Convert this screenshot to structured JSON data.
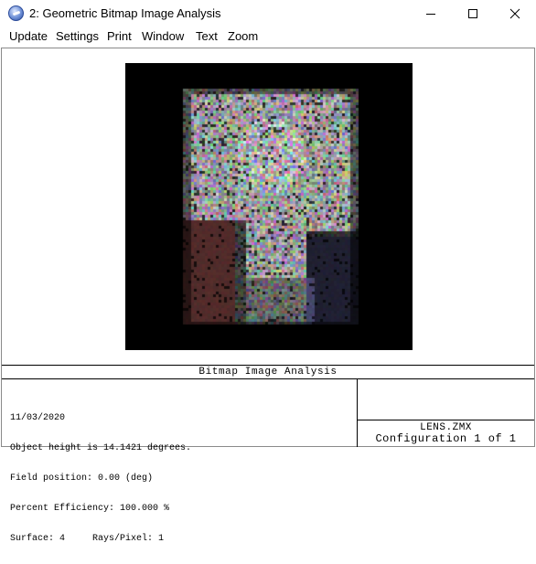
{
  "window": {
    "title": "2: Geometric Bitmap Image Analysis"
  },
  "icons": {
    "app": "zemax-app-icon",
    "minimize": "minimize-icon",
    "maximize": "maximize-icon",
    "close": "close-icon"
  },
  "menu": {
    "items": [
      {
        "label": "Update"
      },
      {
        "label": "Settings"
      },
      {
        "label": "Print"
      },
      {
        "label": "Window"
      },
      {
        "label": "Text"
      },
      {
        "label": "Zoom"
      }
    ]
  },
  "plot": {
    "title": "Bitmap Image Analysis",
    "background_color": "#000000"
  },
  "info": {
    "lines": [
      "11/03/2020",
      "Object height is 14.1421 degrees.",
      "Field position: 0.00 (deg)",
      "Percent Efficiency: 100.000 %",
      "Surface: 4     Rays/Pixel: 1"
    ]
  },
  "titleblock": {
    "lens_file": "LENS.ZMX",
    "configuration": "Configuration 1 of 1"
  }
}
